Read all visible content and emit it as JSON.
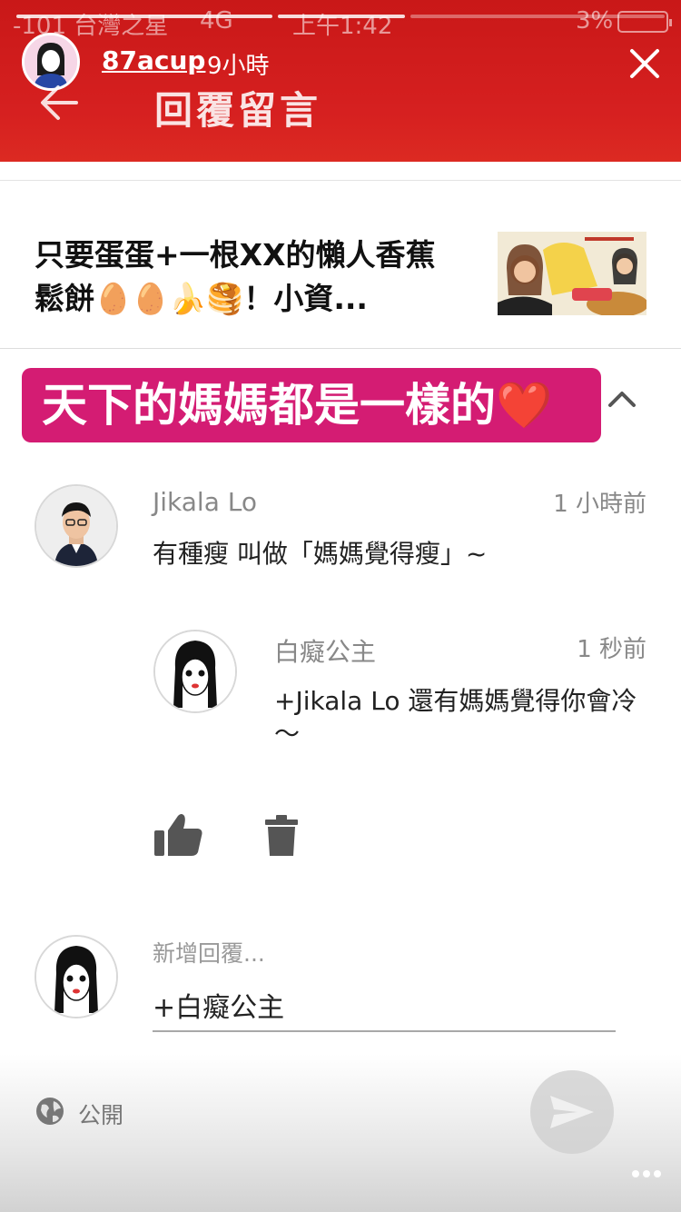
{
  "status_bar": {
    "carrier": "-101 台灣之星",
    "network": "4G",
    "time": "上午1:42",
    "battery": "3%"
  },
  "story": {
    "username": "87acup",
    "age": "9小時"
  },
  "header": {
    "title": "回覆留言"
  },
  "post": {
    "title": "只要蛋蛋+一根XX的懶人香蕉鬆餅🥚🥚🍌🥞！小資..."
  },
  "banner": {
    "text": "天下的媽媽都是一樣的❤️"
  },
  "comments": [
    {
      "author": "Jikala Lo",
      "time": "1 小時前",
      "text": "有種瘦 叫做「媽媽覺得瘦」~"
    },
    {
      "author": "白癡公主",
      "time": "1 秒前",
      "text": "+Jikala Lo 還有媽媽覺得你會冷～"
    }
  ],
  "reply": {
    "placeholder": "新增回覆...",
    "value": "+白癡公主"
  },
  "footer": {
    "privacy": "公開"
  },
  "colors": {
    "header_red": "#d62020",
    "banner_pink": "#d41c73"
  },
  "icons": [
    "close-icon",
    "back-arrow-icon",
    "chevron-up-icon",
    "thumbs-up-icon",
    "trash-icon",
    "globe-icon",
    "send-icon",
    "more-icon"
  ]
}
